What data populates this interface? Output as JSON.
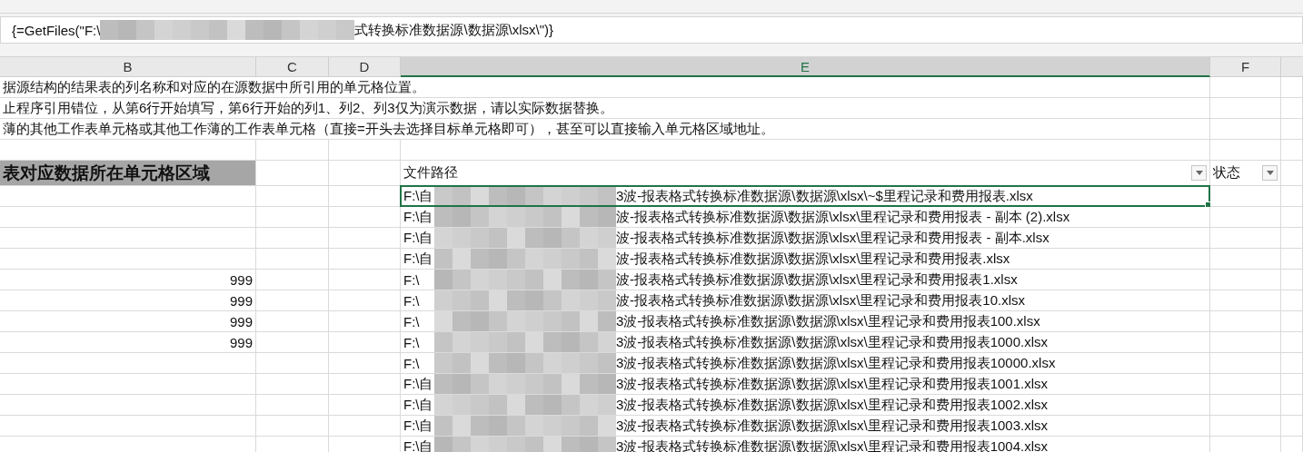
{
  "formula_bar": {
    "prefix": "{=GetFiles(\"F:\\",
    "suffix": "式转换标准数据源\\数据源\\xlsx\\\")}"
  },
  "columns": [
    {
      "label": "B",
      "selected": false
    },
    {
      "label": "C",
      "selected": false
    },
    {
      "label": "D",
      "selected": false
    },
    {
      "label": "E",
      "selected": true
    },
    {
      "label": "F",
      "selected": false
    }
  ],
  "notes": [
    "据源结构的结果表的列名称和对应的在源数据中所引用的单元格位置。",
    "止程序引用错位，从第6行开始填写，第6行开始的列1、列2、列3仅为演示数据，请以实际数据替换。",
    "薄的其他工作表单元格或其他工作薄的工作表单元格（直接=开头去选择目标单元格即可），甚至可以直接输入单元格区域地址。"
  ],
  "header": {
    "range_label": "表对应数据所在单元格区域",
    "path_label": "文件路径",
    "status_label": "状态"
  },
  "rows": [
    {
      "prefix": "F:\\自",
      "suffix": "3波-报表格式转换标准数据源\\数据源\\xlsx\\~$里程记录和费用报表.xlsx",
      "selected": true
    },
    {
      "prefix": "F:\\自",
      "suffix": "波-报表格式转换标准数据源\\数据源\\xlsx\\里程记录和费用报表 - 副本 (2).xlsx",
      "selected": false
    },
    {
      "prefix": "F:\\自",
      "suffix": "波-报表格式转换标准数据源\\数据源\\xlsx\\里程记录和费用报表 - 副本.xlsx",
      "selected": false
    },
    {
      "prefix": "F:\\自",
      "suffix": "波-报表格式转换标准数据源\\数据源\\xlsx\\里程记录和费用报表.xlsx",
      "selected": false
    },
    {
      "value": "999",
      "prefix": "F:\\",
      "suffix": "波-报表格式转换标准数据源\\数据源\\xlsx\\里程记录和费用报表1.xlsx",
      "selected": false
    },
    {
      "value": "999",
      "prefix": "F:\\",
      "suffix": "波-报表格式转换标准数据源\\数据源\\xlsx\\里程记录和费用报表10.xlsx",
      "selected": false
    },
    {
      "value": "999",
      "prefix": "F:\\",
      "suffix": "3波-报表格式转换标准数据源\\数据源\\xlsx\\里程记录和费用报表100.xlsx",
      "selected": false
    },
    {
      "value": "999",
      "prefix": "F:\\",
      "suffix": "3波-报表格式转换标准数据源\\数据源\\xlsx\\里程记录和费用报表1000.xlsx",
      "selected": false
    },
    {
      "prefix": "F:\\",
      "suffix": "3波-报表格式转换标准数据源\\数据源\\xlsx\\里程记录和费用报表10000.xlsx",
      "selected": false
    },
    {
      "prefix": "F:\\自",
      "suffix": "3波-报表格式转换标准数据源\\数据源\\xlsx\\里程记录和费用报表1001.xlsx",
      "selected": false
    },
    {
      "prefix": "F:\\自",
      "suffix": "3波-报表格式转换标准数据源\\数据源\\xlsx\\里程记录和费用报表1002.xlsx",
      "selected": false
    },
    {
      "prefix": "F:\\自",
      "suffix": "3波-报表格式转换标准数据源\\数据源\\xlsx\\里程记录和费用报表1003.xlsx",
      "selected": false
    },
    {
      "prefix": "F:\\自",
      "suffix": "3波-报表格式转换标准数据源\\数据源\\xlsx\\里程记录和费用报表1004.xlsx",
      "selected": false
    }
  ]
}
